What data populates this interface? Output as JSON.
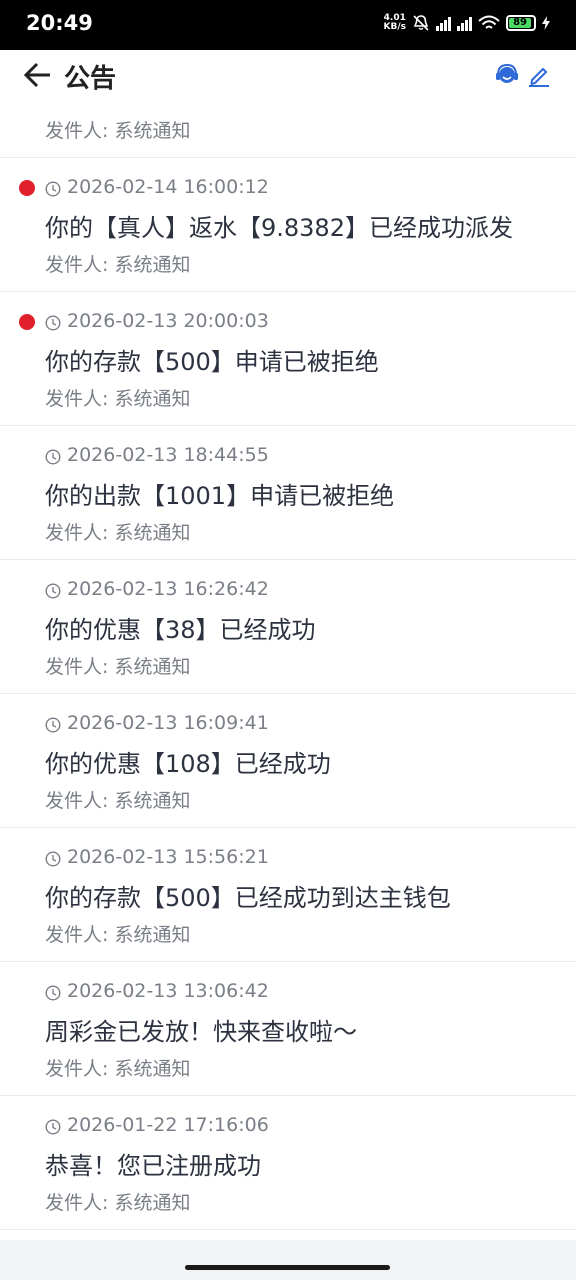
{
  "status_bar": {
    "time": "20:49",
    "net_speed_value": "4.01",
    "net_speed_unit": "KB/s",
    "battery": "89"
  },
  "header": {
    "title": "公告"
  },
  "messages": [
    {
      "time": "",
      "title": "",
      "sender": "发件人: 系统通知",
      "unread": false
    },
    {
      "time": "2026-02-14 16:00:12",
      "title": "你的【真人】返水【9.8382】已经成功派发",
      "sender": "发件人: 系统通知",
      "unread": true
    },
    {
      "time": "2026-02-13 20:00:03",
      "title": "你的存款【500】申请已被拒绝",
      "sender": "发件人: 系统通知",
      "unread": true
    },
    {
      "time": "2026-02-13 18:44:55",
      "title": "你的出款【1001】申请已被拒绝",
      "sender": "发件人: 系统通知",
      "unread": false
    },
    {
      "time": "2026-02-13 16:26:42",
      "title": "你的优惠【38】已经成功",
      "sender": "发件人: 系统通知",
      "unread": false
    },
    {
      "time": "2026-02-13 16:09:41",
      "title": "你的优惠【108】已经成功",
      "sender": "发件人: 系统通知",
      "unread": false
    },
    {
      "time": "2026-02-13 15:56:21",
      "title": "你的存款【500】已经成功到达主钱包",
      "sender": "发件人: 系统通知",
      "unread": false
    },
    {
      "time": "2026-02-13 13:06:42",
      "title": "周彩金已发放！快来查收啦～",
      "sender": "发件人: 系统通知",
      "unread": false
    },
    {
      "time": "2026-01-22 17:16:06",
      "title": "恭喜！您已注册成功",
      "sender": "发件人: 系统通知",
      "unread": false
    }
  ],
  "colors": {
    "unread_dot": "#e0202a",
    "accent": "#2f6bd8"
  }
}
